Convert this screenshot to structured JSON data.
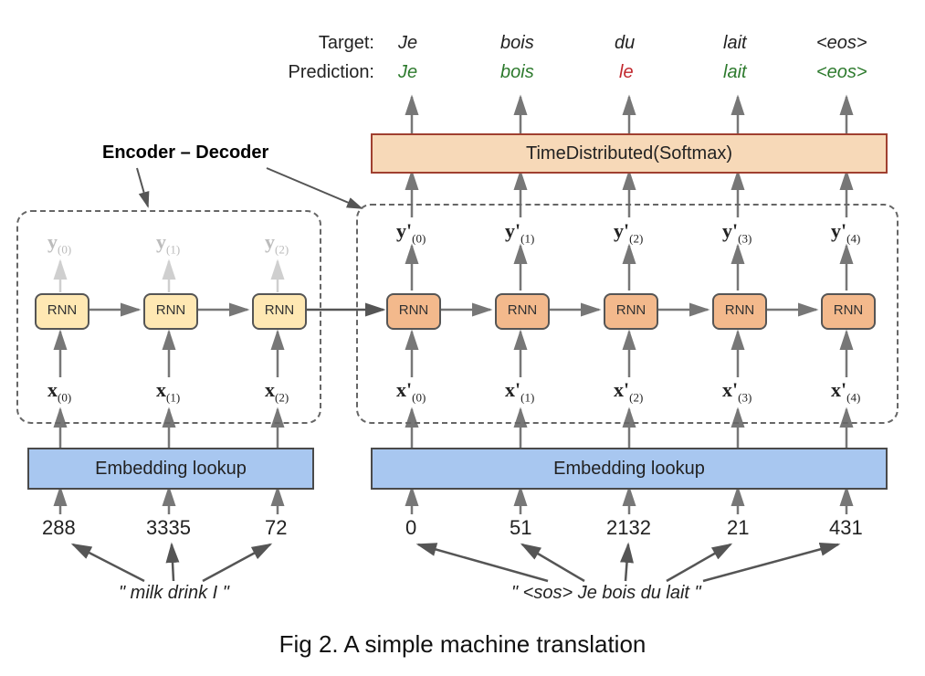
{
  "title_block": {
    "encoder_decoder_label": "Encoder – Decoder",
    "target_label": "Target:",
    "prediction_label": "Prediction:"
  },
  "target_words": [
    "Je",
    "bois",
    "du",
    "lait",
    "<eos>"
  ],
  "prediction_words": [
    {
      "text": "Je",
      "ok": true
    },
    {
      "text": "bois",
      "ok": true
    },
    {
      "text": "le",
      "ok": false
    },
    {
      "text": "lait",
      "ok": true
    },
    {
      "text": "<eos>",
      "ok": true
    }
  ],
  "softmax_label": "TimeDistributed(Softmax)",
  "rnn_label": "RNN",
  "encoder": {
    "y_labels": [
      "y(0)",
      "y(1)",
      "y(2)"
    ],
    "x_labels": [
      "x(0)",
      "x(1)",
      "x(2)"
    ],
    "embedding_label": "Embedding lookup",
    "token_ids": [
      "288",
      "3335",
      "72"
    ],
    "input_text": "\" milk drink I \""
  },
  "decoder": {
    "y_labels": [
      "y'(0)",
      "y'(1)",
      "y'(2)",
      "y'(3)",
      "y'(4)"
    ],
    "x_labels": [
      "x'(0)",
      "x'(1)",
      "x'(2)",
      "x'(3)",
      "x'(4)"
    ],
    "embedding_label": "Embedding lookup",
    "token_ids": [
      "0",
      "51",
      "2132",
      "21",
      "431"
    ],
    "input_text": "\" <sos>  Je bois du lait \""
  },
  "caption": "Fig 2. A simple machine translation"
}
